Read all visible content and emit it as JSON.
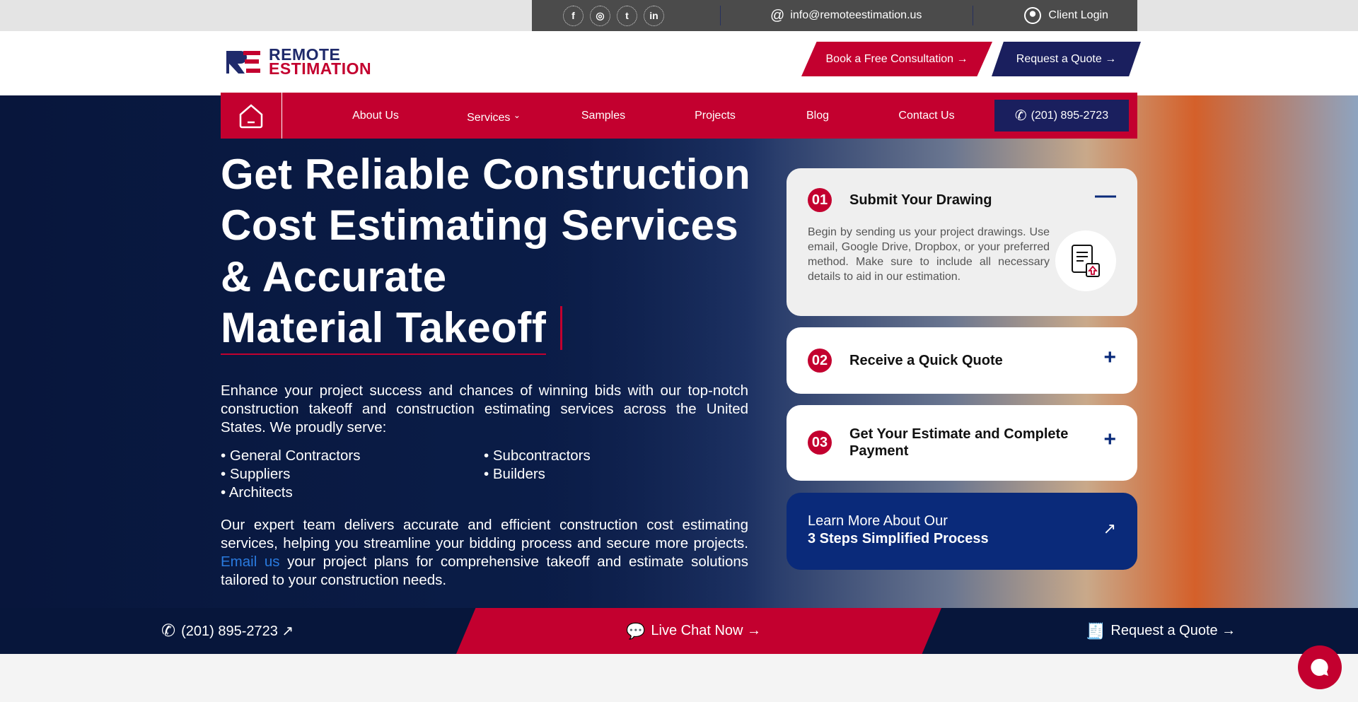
{
  "topbar": {
    "social": [
      {
        "icon": "facebook-icon",
        "glyph": "f"
      },
      {
        "icon": "instagram-icon",
        "glyph": "◎"
      },
      {
        "icon": "twitter-icon",
        "glyph": "t"
      },
      {
        "icon": "linkedin-icon",
        "glyph": "in"
      }
    ],
    "email": "info@remoteestimation.us",
    "client_login": "Client Login"
  },
  "logo": {
    "line1": "REMOTE",
    "line2": "ESTIMATION"
  },
  "header": {
    "consult_btn": "Book a Free Consultation →",
    "quote_btn": "Request a Quote →"
  },
  "nav": {
    "items": [
      "About Us",
      "Services",
      "Samples",
      "Projects",
      "Blog",
      "Contact Us"
    ],
    "phone": "(201) 895-2723"
  },
  "hero": {
    "title_lines": [
      "Get Reliable Construction",
      "Cost Estimating Services",
      "& Accurate",
      "Material Takeoff"
    ],
    "intro": "Enhance your project success and chances of winning bids with our top-notch construction takeoff and construction estimating services across the United States. We proudly serve:",
    "serve_list": [
      "• General Contractors",
      "• Subcontractors",
      "• Suppliers",
      "• Builders",
      "• Architects"
    ],
    "para2_before": "Our expert team delivers accurate and efficient construction cost estimating services, helping you streamline your bidding process and secure more projects. ",
    "para2_link": "Email us",
    "para2_after": " your project plans for comprehensive takeoff and estimate solutions tailored to your construction needs."
  },
  "steps": [
    {
      "num": "01",
      "title": "Submit Your Drawing",
      "body": "Begin by sending us your project drawings. Use email, Google Drive, Dropbox, or your preferred method. Make sure to include all necessary details to aid in our estimation.",
      "toggle": "—"
    },
    {
      "num": "02",
      "title": "Receive a Quick Quote",
      "toggle": "+"
    },
    {
      "num": "03",
      "title": "Get Your Estimate and Complete Payment",
      "toggle": "+"
    }
  ],
  "learn_more": {
    "line1": "Learn More About Our",
    "line2": "3 Steps Simplified Process",
    "arrow": "↗"
  },
  "bottom_strip": {
    "phone": "(201) 895-2723 ↗",
    "live_chat": "Live Chat Now →",
    "quote": "Request a Quote →"
  },
  "colors": {
    "red": "#c3002f",
    "navy": "#07163b",
    "blue": "#0a2a7a",
    "indigo": "#1a1f5e"
  }
}
